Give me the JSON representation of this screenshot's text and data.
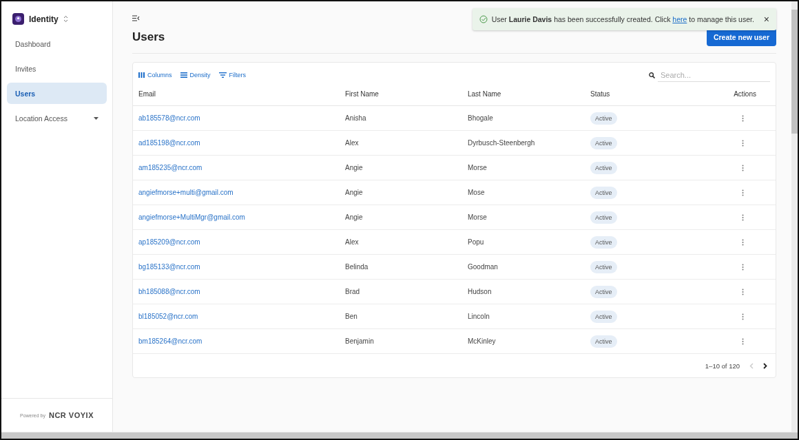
{
  "app": {
    "name": "Identity"
  },
  "sidebar": {
    "items": [
      {
        "label": "Dashboard",
        "selected": false
      },
      {
        "label": "Invites",
        "selected": false
      },
      {
        "label": "Users",
        "selected": true
      },
      {
        "label": "Location Access",
        "selected": false,
        "kind": "dropdown"
      }
    ],
    "footer": {
      "prefix": "Powered by",
      "brand": "NCR VOYIX"
    }
  },
  "page": {
    "title": "Users",
    "primary_button": "Create new user"
  },
  "toast": {
    "message": "User **Laurie Davis** has been successfully created. Click",
    "link": "here",
    "suffix": "to manage this user.",
    "close": "×"
  },
  "toolbar": {
    "buttons": [
      {
        "kind": "columns",
        "label": "Columns"
      },
      {
        "kind": "density",
        "label": "Density"
      },
      {
        "kind": "filters",
        "label": "Filters"
      }
    ],
    "search": {
      "placeholder": "Search..."
    }
  },
  "table": {
    "columns": [
      "Email",
      "First Name",
      "Last Name",
      "Status",
      "Actions"
    ],
    "rows": [
      {
        "email": "ab185578@ncr.com",
        "first": "Anisha",
        "last": "Bhogale",
        "status": "Active"
      },
      {
        "email": "ad185198@ncr.com",
        "first": "Alex",
        "last": "Dyrbusch-Steenbergh",
        "status": "Active"
      },
      {
        "email": "am185235@ncr.com",
        "first": "Angie",
        "last": "Morse",
        "status": "Active"
      },
      {
        "email": "angiefmorse+multi@gmail.com",
        "first": "Angie",
        "last": "Mose",
        "status": "Active"
      },
      {
        "email": "angiefmorse+MultiMgr@gmail.com",
        "first": "Angie",
        "last": "Morse",
        "status": "Active"
      },
      {
        "email": "ap185209@ncr.com",
        "first": "Alex",
        "last": "Popu",
        "status": "Active"
      },
      {
        "email": "bg185133@ncr.com",
        "first": "Belinda",
        "last": "Goodman",
        "status": "Active"
      },
      {
        "email": "bh185088@ncr.com",
        "first": "Brad",
        "last": "Hudson",
        "status": "Active"
      },
      {
        "email": "bl185052@ncr.com",
        "first": "Ben",
        "last": "Lincoln",
        "status": "Active"
      },
      {
        "email": "bm185264@ncr.com",
        "first": "Benjamin",
        "last": "McKinley",
        "status": "Active"
      }
    ]
  },
  "pagination": {
    "range": "1–10 of 120",
    "prev_disabled": true,
    "next_disabled": false
  }
}
